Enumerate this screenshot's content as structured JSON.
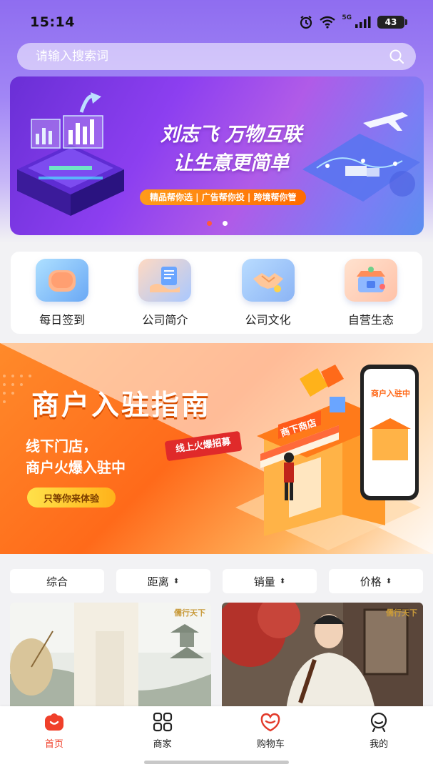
{
  "status_bar": {
    "time": "15:14",
    "network": "5G",
    "battery": "43"
  },
  "search": {
    "placeholder": "请输入搜索词"
  },
  "banner": {
    "headline_line1": "刘志飞  万物互联",
    "headline_line2": "让生意更简单",
    "tagline": "精品帮你选 | 广告帮你投 | 跨境帮你管",
    "page_count": 2,
    "active_page": 1
  },
  "shortcuts": [
    {
      "label": "每日签到",
      "icon": "check-in-icon"
    },
    {
      "label": "公司简介",
      "icon": "company-intro-icon"
    },
    {
      "label": "公司文化",
      "icon": "handshake-icon"
    },
    {
      "label": "自营生态",
      "icon": "self-operated-shop-icon"
    }
  ],
  "merchant_banner": {
    "title": "商户入驻指南",
    "line1": "线下门店，",
    "line2": "商户火爆入驻中",
    "button": "只等你来体验",
    "ribbon": "线上火爆招募",
    "store_sign": "商下商店",
    "phone_text": "商户入驻中"
  },
  "filters": [
    {
      "label": "综合",
      "sortable": false
    },
    {
      "label": "距离",
      "sortable": true
    },
    {
      "label": "销量",
      "sortable": true
    },
    {
      "label": "价格",
      "sortable": true
    }
  ],
  "products": [
    {
      "brand": "儒行天下"
    },
    {
      "brand": "儒行天下"
    }
  ],
  "bottom_nav": [
    {
      "label": "首页",
      "icon": "home-icon",
      "active": true
    },
    {
      "label": "商家",
      "icon": "grid-icon",
      "active": false
    },
    {
      "label": "购物车",
      "icon": "cart-heart-icon",
      "active": false
    },
    {
      "label": "我的",
      "icon": "profile-icon",
      "active": false
    }
  ],
  "colors": {
    "accent": "#f0402a",
    "hero_purple": "#8f6df0",
    "merchant_orange": "#ff6a1a"
  }
}
